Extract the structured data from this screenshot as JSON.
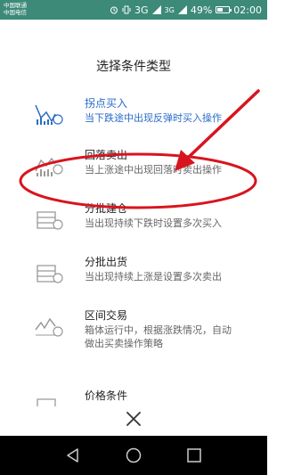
{
  "status_bar": {
    "carrier_1": "中国联通",
    "carrier_2": "中国电信",
    "network": "3G",
    "network_small": "3G",
    "battery_text": "49%",
    "battery_level": 0.49,
    "time": "02:00"
  },
  "dialog": {
    "title": "选择条件类型",
    "items": [
      {
        "name": "拐点买入",
        "desc": "当下跌途中出现反弹时买入操作",
        "icon": "bottom-buy-icon"
      },
      {
        "name": "回落卖出",
        "desc": "当上涨途中出现回落时卖出操作",
        "icon": "pullback-sell-icon"
      },
      {
        "name": "分批建仓",
        "desc": "当出现持续下跌时设置多次买入",
        "icon": "batch-build-icon"
      },
      {
        "name": "分批出货",
        "desc": "当出现持续上涨是设置多次卖出",
        "icon": "batch-sell-icon"
      },
      {
        "name": "区间交易",
        "desc": "箱体运行中，根据涨跌情况，自动做出买卖操作策略",
        "icon": "range-trade-icon"
      },
      {
        "name": "价格条件",
        "desc": "",
        "icon": "price-condition-icon"
      }
    ],
    "close_icon": "close-icon"
  },
  "annotation_color": "#d8141e",
  "accent_color": "#2a6cc8"
}
